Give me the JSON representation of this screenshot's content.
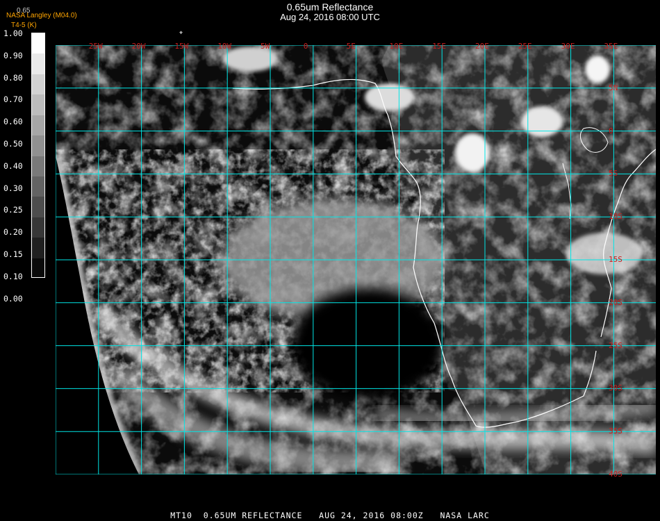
{
  "header": {
    "title": "0.65um Reflectance",
    "timestamp": "Aug 24, 2016 08:00 UTC",
    "credit_line1": "NASA Langley (M04.0)",
    "credit_line2": "T4-5 (K)",
    "partial_label": "0.65"
  },
  "colorbar": {
    "labels": [
      "1.00",
      "0.90",
      "0.80",
      "0.70",
      "0.60",
      "0.50",
      "0.40",
      "0.30",
      "0.25",
      "0.20",
      "0.15",
      "0.10",
      "0.00"
    ]
  },
  "grid": {
    "lon_labels": [
      "25W",
      "20W",
      "15W",
      "10W",
      "5W",
      "0",
      "5E",
      "10E",
      "15E",
      "20E",
      "25E",
      "30E",
      "35E"
    ],
    "lat_labels": [
      "5N",
      "0",
      "5S",
      "10S",
      "15S",
      "20S",
      "25S",
      "30S",
      "35S",
      "40S"
    ],
    "line_color": "#00e6e6",
    "label_color": "#c81e1e"
  },
  "footer": {
    "text": "MT10  0.65UM REFLECTANCE   AUG 24, 2016 08:00Z   NASA LARC"
  },
  "colors": {
    "background": "#000000",
    "coastline": "#ffffff",
    "ocean": "#0a0a0a",
    "credit": "#ffa500"
  }
}
